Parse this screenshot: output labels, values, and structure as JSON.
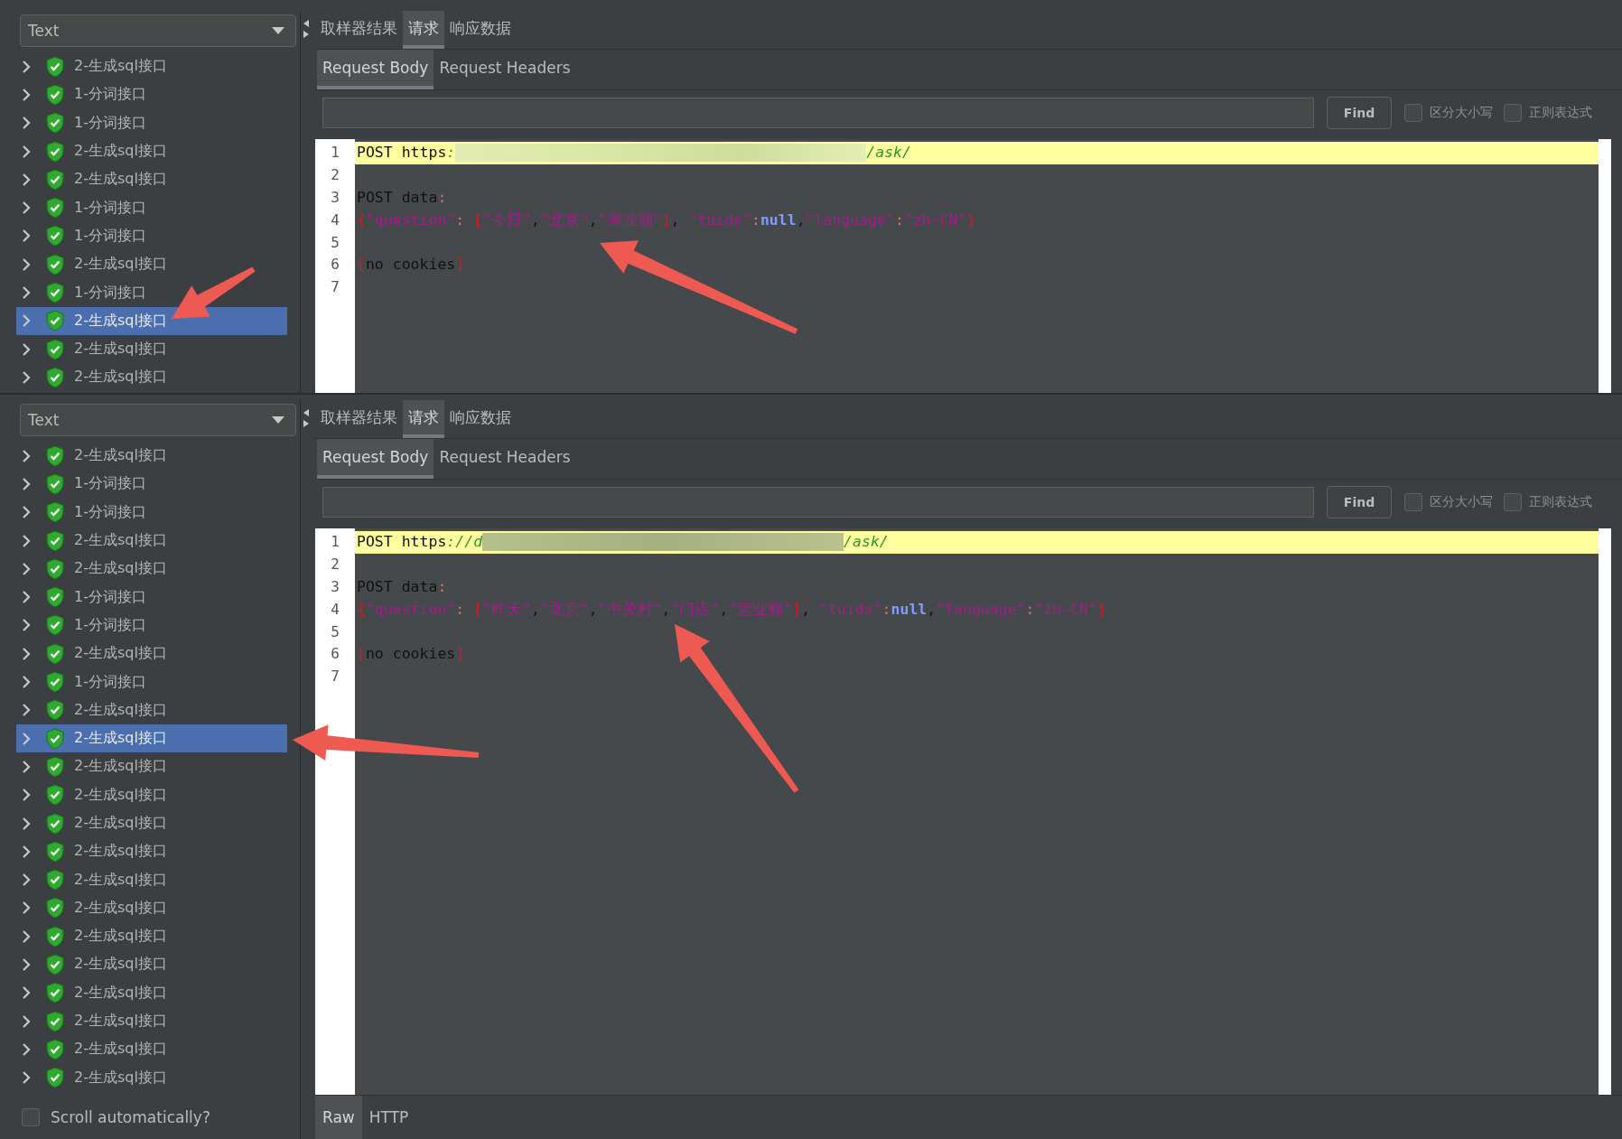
{
  "panels": [
    {
      "view_selector": "Text",
      "tree": [
        {
          "label": "2-生成sql接口",
          "selected": false
        },
        {
          "label": "1-分词接口",
          "selected": false
        },
        {
          "label": "1-分词接口",
          "selected": false
        },
        {
          "label": "2-生成sql接口",
          "selected": false
        },
        {
          "label": "2-生成sql接口",
          "selected": false
        },
        {
          "label": "1-分词接口",
          "selected": false
        },
        {
          "label": "1-分词接口",
          "selected": false
        },
        {
          "label": "2-生成sql接口",
          "selected": false
        },
        {
          "label": "1-分词接口",
          "selected": false
        },
        {
          "label": "2-生成sql接口",
          "selected": true
        },
        {
          "label": "2-生成sql接口",
          "selected": false
        },
        {
          "label": "2-生成sql接口",
          "selected": false
        }
      ],
      "result_tabs": [
        {
          "label": "取样器结果",
          "selected": false
        },
        {
          "label": "请求",
          "selected": true
        },
        {
          "label": "响应数据",
          "selected": false
        }
      ],
      "request_tabs": [
        {
          "label": "Request Body",
          "selected": true
        },
        {
          "label": "Request Headers",
          "selected": false
        }
      ],
      "find_button": "Find",
      "options": [
        {
          "label": "区分大小写",
          "checked": false
        },
        {
          "label": "正则表达式",
          "checked": false
        }
      ],
      "code_lines": [
        {
          "number": "1",
          "highlighted": true,
          "tokens": [
            {
              "text": "POST https",
              "kind": "plain"
            },
            {
              "text": ":",
              "kind": "url"
            },
            {
              "kind": "redacted"
            },
            {
              "text": "/ask/",
              "kind": "url"
            }
          ]
        },
        {
          "number": "2",
          "highlighted": false
        },
        {
          "number": "3",
          "highlighted": false,
          "tokens": [
            {
              "text": "POST data",
              "kind": "plain"
            },
            {
              "text": ":",
              "kind": "faint"
            }
          ]
        },
        {
          "number": "4",
          "highlighted": false,
          "tokens": [
            {
              "text": "{",
              "kind": "punct"
            },
            {
              "text": "\"question\"",
              "kind": "key"
            },
            {
              "text": ": ",
              "kind": "faint"
            },
            {
              "text": "[",
              "kind": "punct"
            },
            {
              "text": "\"今日\"",
              "kind": "key"
            },
            {
              "text": ",",
              "kind": "plain"
            },
            {
              "text": "\"北京\"",
              "kind": "key"
            },
            {
              "text": ",",
              "kind": "plain"
            },
            {
              "text": "\"营业额\"",
              "kind": "key"
            },
            {
              "text": "]",
              "kind": "punct"
            },
            {
              "text": ", ",
              "kind": "plain"
            },
            {
              "text": "\"tuids\"",
              "kind": "key"
            },
            {
              "text": ":",
              "kind": "faint"
            },
            {
              "text": "null",
              "kind": "null"
            },
            {
              "text": ",",
              "kind": "plain"
            },
            {
              "text": "\"language\"",
              "kind": "key"
            },
            {
              "text": ":",
              "kind": "faint"
            },
            {
              "text": "\"zh-CN\"",
              "kind": "key"
            },
            {
              "text": "}",
              "kind": "punct"
            }
          ]
        },
        {
          "number": "5",
          "highlighted": false
        },
        {
          "number": "6",
          "highlighted": false,
          "tokens": [
            {
              "text": "[",
              "kind": "punct"
            },
            {
              "text": "no cookies",
              "kind": "plain"
            },
            {
              "text": "]",
              "kind": "punct"
            }
          ]
        },
        {
          "number": "7",
          "highlighted": false
        }
      ]
    },
    {
      "view_selector": "Text",
      "tree": [
        {
          "label": "2-生成sql接口",
          "selected": false
        },
        {
          "label": "1-分词接口",
          "selected": false
        },
        {
          "label": "1-分词接口",
          "selected": false
        },
        {
          "label": "2-生成sql接口",
          "selected": false
        },
        {
          "label": "2-生成sql接口",
          "selected": false
        },
        {
          "label": "1-分词接口",
          "selected": false
        },
        {
          "label": "1-分词接口",
          "selected": false
        },
        {
          "label": "2-生成sql接口",
          "selected": false
        },
        {
          "label": "1-分词接口",
          "selected": false
        },
        {
          "label": "2-生成sql接口",
          "selected": false
        },
        {
          "label": "2-生成sql接口",
          "selected": true
        },
        {
          "label": "2-生成sql接口",
          "selected": false
        },
        {
          "label": "2-生成sql接口",
          "selected": false
        },
        {
          "label": "2-生成sql接口",
          "selected": false
        },
        {
          "label": "2-生成sql接口",
          "selected": false
        },
        {
          "label": "2-生成sql接口",
          "selected": false
        },
        {
          "label": "2-生成sql接口",
          "selected": false
        },
        {
          "label": "2-生成sql接口",
          "selected": false
        },
        {
          "label": "2-生成sql接口",
          "selected": false
        },
        {
          "label": "2-生成sql接口",
          "selected": false
        },
        {
          "label": "2-生成sql接口",
          "selected": false
        },
        {
          "label": "2-生成sql接口",
          "selected": false
        },
        {
          "label": "2-生成sql接口",
          "selected": false
        }
      ],
      "result_tabs": [
        {
          "label": "取样器结果",
          "selected": false
        },
        {
          "label": "请求",
          "selected": true
        },
        {
          "label": "响应数据",
          "selected": false
        }
      ],
      "request_tabs": [
        {
          "label": "Request Body",
          "selected": true
        },
        {
          "label": "Request Headers",
          "selected": false
        }
      ],
      "find_button": "Find",
      "options": [
        {
          "label": "区分大小写",
          "checked": false
        },
        {
          "label": "正则表达式",
          "checked": false
        }
      ],
      "code_lines": [
        {
          "number": "1",
          "highlighted": true,
          "tokens": [
            {
              "text": "POST https",
              "kind": "plain"
            },
            {
              "text": "://d",
              "kind": "url"
            },
            {
              "kind": "redacted"
            },
            {
              "text": "/ask/",
              "kind": "url"
            }
          ]
        },
        {
          "number": "2",
          "highlighted": false
        },
        {
          "number": "3",
          "highlighted": false,
          "tokens": [
            {
              "text": "POST data",
              "kind": "plain"
            },
            {
              "text": ":",
              "kind": "faint"
            }
          ]
        },
        {
          "number": "4",
          "highlighted": false,
          "tokens": [
            {
              "text": "{",
              "kind": "punct"
            },
            {
              "text": "\"question\"",
              "kind": "key"
            },
            {
              "text": ": ",
              "kind": "faint"
            },
            {
              "text": "[",
              "kind": "punct"
            },
            {
              "text": "\"昨天\"",
              "kind": "key"
            },
            {
              "text": ",",
              "kind": "plain"
            },
            {
              "text": "\"北京\"",
              "kind": "key"
            },
            {
              "text": ",",
              "kind": "plain"
            },
            {
              "text": "\"中关村\"",
              "kind": "key"
            },
            {
              "text": ",",
              "kind": "plain"
            },
            {
              "text": "\"门店\"",
              "kind": "key"
            },
            {
              "text": ",",
              "kind": "plain"
            },
            {
              "text": "\"营业额\"",
              "kind": "key"
            },
            {
              "text": "]",
              "kind": "punct"
            },
            {
              "text": ", ",
              "kind": "plain"
            },
            {
              "text": "\"tuids\"",
              "kind": "key"
            },
            {
              "text": ":",
              "kind": "faint"
            },
            {
              "text": "null",
              "kind": "null"
            },
            {
              "text": ",",
              "kind": "plain"
            },
            {
              "text": "\"language\"",
              "kind": "key"
            },
            {
              "text": ":",
              "kind": "faint"
            },
            {
              "text": "\"zh-CN\"",
              "kind": "key"
            },
            {
              "text": "}",
              "kind": "punct"
            }
          ]
        },
        {
          "number": "5",
          "highlighted": false
        },
        {
          "number": "6",
          "highlighted": false,
          "tokens": [
            {
              "text": "[",
              "kind": "punct"
            },
            {
              "text": "no cookies",
              "kind": "plain"
            },
            {
              "text": "]",
              "kind": "punct"
            }
          ]
        },
        {
          "number": "7",
          "highlighted": false
        }
      ],
      "format_tabs": [
        {
          "label": "Raw",
          "selected": true
        },
        {
          "label": "HTTP",
          "selected": false
        }
      ],
      "scroll_automatically": {
        "label": "Scroll automatically?",
        "checked": false
      }
    }
  ]
}
